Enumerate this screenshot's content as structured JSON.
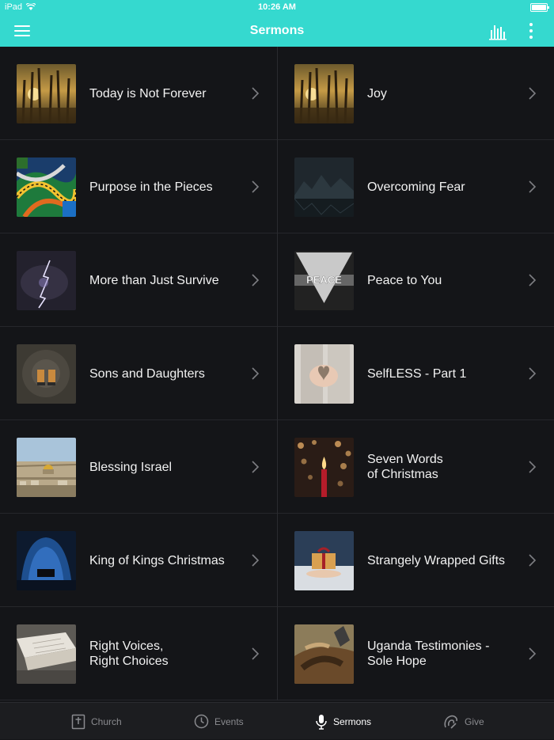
{
  "status_bar": {
    "carrier": "iPad",
    "time": "10:26 AM"
  },
  "navbar": {
    "title": "Sermons"
  },
  "sermons": [
    [
      "Today is Not Forever",
      "Joy"
    ],
    [
      "Purpose in the Pieces",
      "Overcoming Fear"
    ],
    [
      "More than Just Survive",
      "Peace to You"
    ],
    [
      "Sons and Daughters",
      "SelfLESS - Part 1"
    ],
    [
      "Blessing Israel",
      "Seven Words\nof Christmas"
    ],
    [
      "King of Kings Christmas",
      "Strangely Wrapped Gifts"
    ],
    [
      "Right Voices,\nRight Choices",
      "Uganda Testimonies -\nSole Hope"
    ]
  ],
  "thumb_peace_text": "PEACE",
  "tabs": [
    {
      "label": "Church",
      "active": false
    },
    {
      "label": "Events",
      "active": false
    },
    {
      "label": "Sermons",
      "active": true
    },
    {
      "label": "Give",
      "active": false
    }
  ],
  "colors": {
    "header": "#35d9cf",
    "background": "#141518",
    "tabbar": "#1c1d20"
  }
}
